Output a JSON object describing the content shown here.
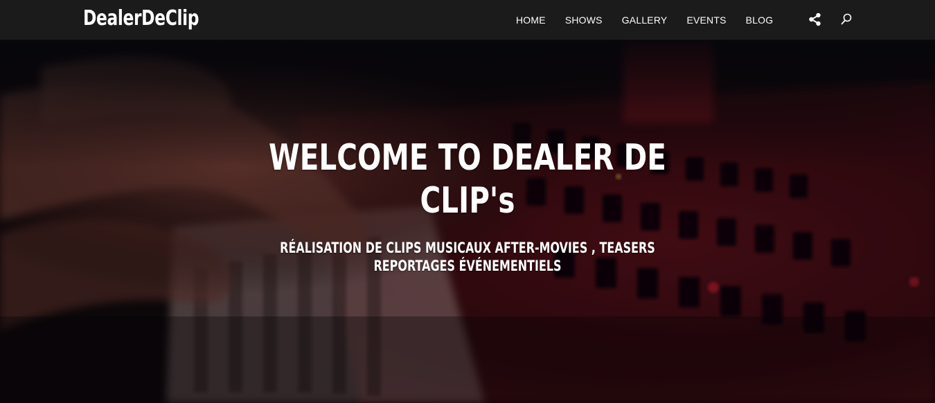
{
  "header": {
    "logo": "DealerDeClip",
    "nav": [
      {
        "label": "HOME"
      },
      {
        "label": "SHOWS"
      },
      {
        "label": "GALLERY"
      },
      {
        "label": "EVENTS"
      },
      {
        "label": "BLOG"
      }
    ],
    "icons": [
      "share-icon",
      "search-icon"
    ],
    "background_color": "#1b1b1b"
  },
  "hero": {
    "title": "WELCOME TO DEALER DE CLIP's",
    "subtitle": "RÉALISATION DE CLIPS MUSICAUX AFTER-MOVIES , TEASERS REPORTAGES ÉVÉNEMENTIELS",
    "background_image": "hands playing a red keyboard synthesizer",
    "accent_color": "#b0182a"
  }
}
